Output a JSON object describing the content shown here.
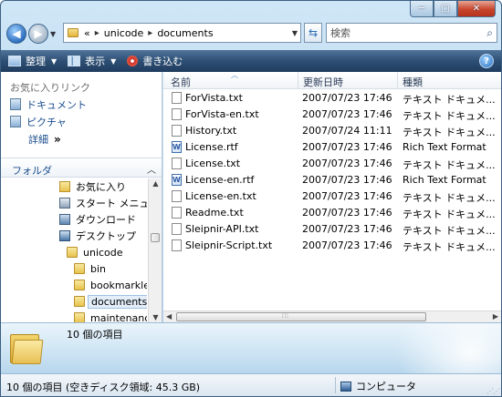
{
  "window": {
    "caption_buttons": {
      "minimize": "─",
      "maximize": "□",
      "close": "✕"
    }
  },
  "address": {
    "prefix": "«",
    "crumbs": [
      "unicode",
      "documents"
    ],
    "separator": "▸",
    "refresh_glyph": "⇆"
  },
  "search": {
    "placeholder": "検索"
  },
  "toolbar": {
    "organize_label": "整理",
    "views_label": "表示",
    "burn_label": "書き込む",
    "help_glyph": "?"
  },
  "navpane": {
    "favorites_header": "お気に入りリンク",
    "favorites": [
      {
        "label": "ドキュメント",
        "icon": "documents-icon"
      },
      {
        "label": "ピクチャ",
        "icon": "pictures-icon"
      }
    ],
    "more_label": "詳細",
    "more_glyph": "»",
    "folders_header": "フォルダ",
    "tree": [
      {
        "label": "お気に入り",
        "icon": "favorites-folder-icon",
        "indent": 1
      },
      {
        "label": "スタート メニュー",
        "icon": "start-menu-icon",
        "indent": 1
      },
      {
        "label": "ダウンロード",
        "icon": "downloads-icon",
        "indent": 1
      },
      {
        "label": "デスクトップ",
        "icon": "desktop-icon",
        "indent": 1
      },
      {
        "label": "unicode",
        "icon": "folder-icon",
        "indent": 2
      },
      {
        "label": "bin",
        "icon": "folder-icon",
        "indent": 3
      },
      {
        "label": "bookmarklet",
        "icon": "folder-icon",
        "indent": 3
      },
      {
        "label": "documents",
        "icon": "folder-icon",
        "indent": 3,
        "selected": true
      },
      {
        "label": "maintenance",
        "icon": "folder-icon",
        "indent": 3
      }
    ]
  },
  "filelist": {
    "columns": {
      "name": "名前",
      "modified": "更新日時",
      "type": "種類"
    },
    "rows": [
      {
        "name": "ForVista.txt",
        "date": "2007/07/23 17:46",
        "type": "テキスト ドキュメ...",
        "icon": "text-file-icon"
      },
      {
        "name": "ForVista-en.txt",
        "date": "2007/07/23 17:46",
        "type": "テキスト ドキュメ...",
        "icon": "text-file-icon"
      },
      {
        "name": "History.txt",
        "date": "2007/07/24 11:11",
        "type": "テキスト ドキュメ...",
        "icon": "text-file-icon"
      },
      {
        "name": "License.rtf",
        "date": "2007/07/23 17:46",
        "type": "Rich Text Format",
        "icon": "rtf-file-icon"
      },
      {
        "name": "License.txt",
        "date": "2007/07/23 17:46",
        "type": "テキスト ドキュメ...",
        "icon": "text-file-icon"
      },
      {
        "name": "License-en.rtf",
        "date": "2007/07/23 17:46",
        "type": "Rich Text Format",
        "icon": "rtf-file-icon"
      },
      {
        "name": "License-en.txt",
        "date": "2007/07/23 17:46",
        "type": "テキスト ドキュメ...",
        "icon": "text-file-icon"
      },
      {
        "name": "Readme.txt",
        "date": "2007/07/23 17:46",
        "type": "テキスト ドキュメ...",
        "icon": "text-file-icon"
      },
      {
        "name": "Sleipnir-API.txt",
        "date": "2007/07/23 17:46",
        "type": "テキスト ドキュメ...",
        "icon": "text-file-icon"
      },
      {
        "name": "Sleipnir-Script.txt",
        "date": "2007/07/23 17:46",
        "type": "テキスト ドキュメ...",
        "icon": "text-file-icon"
      }
    ]
  },
  "details": {
    "item_count": "10 個の項目"
  },
  "statusbar": {
    "left": "10 個の項目 (空きディスク領域: 45.3 GB)",
    "location": "コンピュータ"
  }
}
